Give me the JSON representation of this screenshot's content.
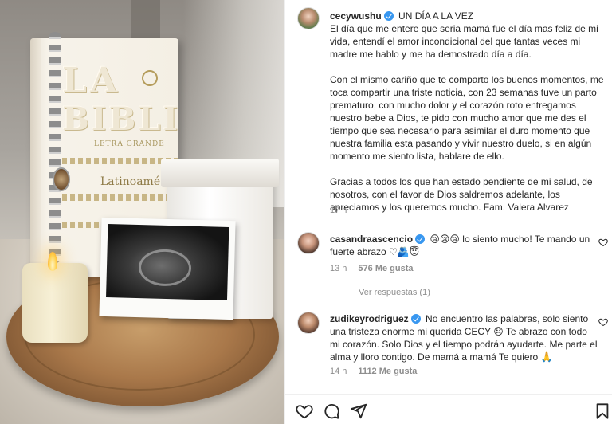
{
  "post": {
    "username": "cecywushu",
    "title": "UN DÍA A LA VEZ",
    "caption_lines": [
      "El día que me entere que seria mamá fue el día mas feliz de mi",
      "vida, entendí el amor incondicional del que tantas veces mi",
      "madre me hablo y me ha demostrado día a día.",
      "",
      "Con el mismo cariño que te comparto los buenos momentos, me",
      "toca compartir una triste noticia, con 23 semanas tuve un parto",
      "prematuro, con mucho dolor y el corazón roto entregamos",
      "nuestro bebe a Dios, te pido con mucho amor que me des el",
      "tiempo que sea necesario para asimilar el duro momento que",
      "nuestra familia esta pasando y vivir nuestro duelo, si en algún",
      "momento me siento lista, hablare de ello.",
      "",
      "Gracias a todos los que han estado pendiente de mi salud, de",
      "nosotros, con el favor de Dios saldremos adelante, los",
      "apreciamos y los queremos mucho. Fam. Valera Alvarez"
    ],
    "time": "17 h"
  },
  "book": {
    "title_line1": "LA",
    "title_line2": "BIBLIA",
    "subtitle": "LETRA GRANDE",
    "brand": "Latinoamé"
  },
  "comments": [
    {
      "username": "casandraascencio",
      "line1": "lo siento mucho! Te mando un",
      "line2": "fuerte abrazo",
      "emoji1": "😢😢😢",
      "emoji2": "♡🫂😇",
      "time": "13 h",
      "likes": "576 Me gusta"
    },
    {
      "username": "zudikeyrodriguez",
      "line1": "No encuentro las palabras, solo siento",
      "line2": "una tristeza enorme mi querida CECY",
      "line2_emoji": "😞",
      "line2_tail": "Te abrazo con todo",
      "line3": "mi corazón. Solo Dios y el tiempo podrán ayudarte. Me parte el",
      "line4": "alma y lloro contigo. De mamá a mamá Te quiero",
      "line4_emoji": "🙏",
      "time": "14 h",
      "likes": "1112 Me gusta"
    }
  ],
  "view_replies": "Ver respuestas (1)",
  "icons": {
    "verified": "verified-badge-icon",
    "heart": "heart-icon",
    "comment": "comment-icon",
    "share": "share-icon",
    "save": "bookmark-icon"
  },
  "colors": {
    "verified": "#3897f0",
    "muted": "#8e8e8e",
    "text": "#262626"
  }
}
